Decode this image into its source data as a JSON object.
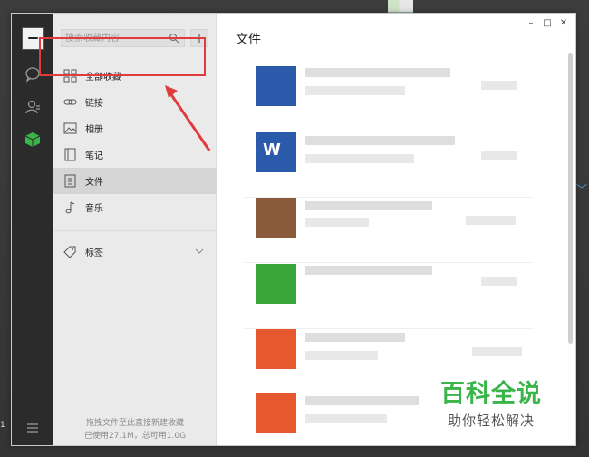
{
  "search": {
    "placeholder": "搜索收藏内容"
  },
  "add_button_label": "+",
  "nav": {
    "items": [
      {
        "label": "全部收藏",
        "icon": "grid-icon"
      },
      {
        "label": "链接",
        "icon": "link-icon"
      },
      {
        "label": "相册",
        "icon": "image-icon"
      },
      {
        "label": "笔记",
        "icon": "note-icon"
      },
      {
        "label": "文件",
        "icon": "file-icon",
        "active": true
      },
      {
        "label": "音乐",
        "icon": "music-icon"
      }
    ],
    "tags_label": "标签"
  },
  "footer": {
    "hint": "拖拽文件至此直接新建收藏",
    "usage": "已使用27.1M，总可用1.0G"
  },
  "content": {
    "title": "文件"
  },
  "window_controls": {
    "minimize": "–",
    "maximize": "□",
    "close": "✕"
  },
  "files": [
    {
      "icon": "word-doc-icon",
      "color": "#2b5aab"
    },
    {
      "icon": "word-doc-icon",
      "color": "#2b5aab",
      "letter": "W"
    },
    {
      "icon": "image-file-icon",
      "color": "#8a5b3a"
    },
    {
      "icon": "audio-file-icon",
      "color": "#3aa63a"
    },
    {
      "icon": "ppt-file-icon",
      "color": "#e8582f"
    },
    {
      "icon": "ppt-file-icon",
      "color": "#e8582f"
    }
  ],
  "watermark": {
    "title": "百科全说",
    "subtitle": "助你轻松解决"
  },
  "desktop": {
    "edge_text": "1"
  },
  "colors": {
    "accent_green": "#3bb54a",
    "highlight_red": "#e03c3c"
  }
}
